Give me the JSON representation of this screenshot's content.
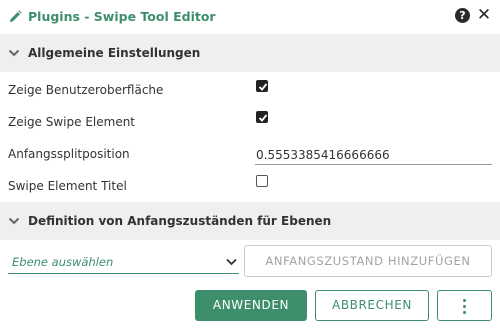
{
  "header": {
    "title": "Plugins - Swipe Tool Editor",
    "icons": {
      "edit": "pencil-icon",
      "help": "help-circle-icon",
      "close": "close-icon"
    },
    "help_symbol": "?",
    "close_symbol": "✕"
  },
  "general": {
    "title": "Allgemeine Einstellungen",
    "fields": {
      "show_ui": {
        "label": "Zeige Benutzeroberfläche",
        "checked": true
      },
      "show_swipe": {
        "label": "Zeige Swipe Element",
        "checked": true
      },
      "split_position": {
        "label": "Anfangssplitposition",
        "value": "0.5553385416666666"
      },
      "swipe_title": {
        "label": "Swipe Element Titel",
        "checked": false
      }
    }
  },
  "layers": {
    "title": "Definition von Anfangszuständen für Ebenen",
    "select_placeholder": "Ebene auswählen",
    "add_button": "ANFANGSZUSTAND HINZUFÜGEN"
  },
  "footer": {
    "apply": "ANWENDEN",
    "cancel": "ABBRECHEN",
    "more_icon": "more-vertical-icon"
  },
  "colors": {
    "accent": "#3d8f6c",
    "section_bg": "#efefef",
    "disabled_text": "#a3a3a3"
  }
}
